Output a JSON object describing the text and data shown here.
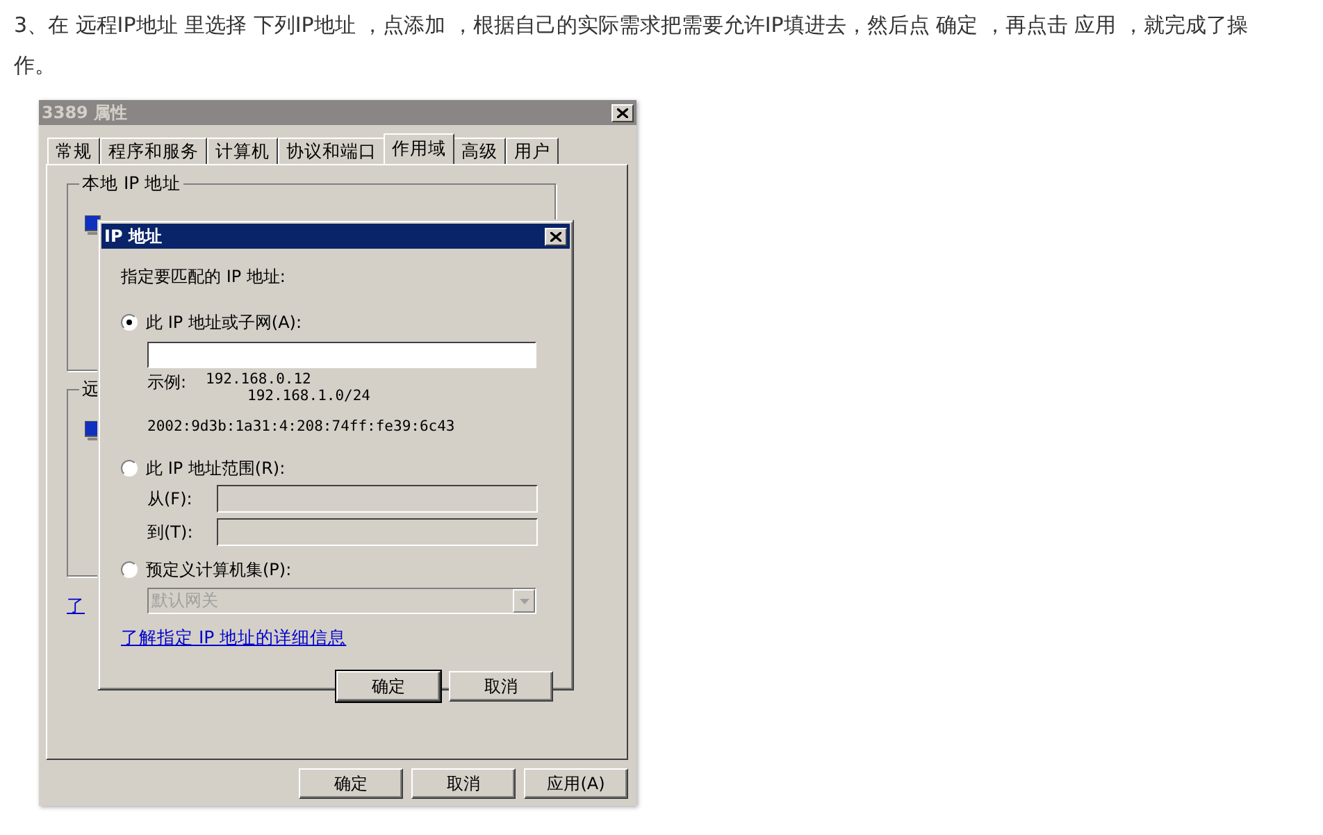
{
  "article": {
    "paragraph": "3、在 远程IP地址 里选择 下列IP地址 ，点添加 ，根据自己的实际需求把需要允许IP填进去，然后点 确定 ，再点击 应用 ，就完成了操作。"
  },
  "properties_dialog": {
    "title": "3389 属性",
    "active": false,
    "tabs": [
      {
        "label": "常规",
        "selected": false
      },
      {
        "label": "程序和服务",
        "selected": false
      },
      {
        "label": "计算机",
        "selected": false
      },
      {
        "label": "协议和端口",
        "selected": false
      },
      {
        "label": "作用域",
        "selected": true
      },
      {
        "label": "高级",
        "selected": false
      },
      {
        "label": "用户",
        "selected": false
      }
    ],
    "groups": [
      {
        "label": "本地 IP 地址"
      },
      {
        "label": "远"
      }
    ],
    "link": "了",
    "buttons": [
      "确定",
      "取消",
      "应用(A)"
    ]
  },
  "ip_dialog": {
    "title": "IP 地址",
    "active": true,
    "prompt": "指定要匹配的 IP 地址:",
    "options": [
      {
        "kind": "subnet",
        "label": "此 IP 地址或子网(A):",
        "selected": true,
        "example_label": "示例:",
        "examples": [
          "192.168.0.12",
          "192.168.1.0/24"
        ],
        "ipv6_example": "2002:9d3b:1a31:4:208:74ff:fe39:6c43"
      },
      {
        "kind": "range",
        "label": "此 IP 地址范围(R):",
        "selected": false,
        "fields": [
          {
            "label": "从(F):"
          },
          {
            "label": "到(T):"
          }
        ]
      },
      {
        "kind": "predefined",
        "label": "预定义计算机集(P):",
        "selected": false,
        "dropdown": {
          "value": "默认网关",
          "disabled": true
        }
      }
    ],
    "link": "了解指定 IP 地址的详细信息",
    "buttons": [
      {
        "label": "确定",
        "default": true
      },
      {
        "label": "取消",
        "default": false
      }
    ]
  }
}
